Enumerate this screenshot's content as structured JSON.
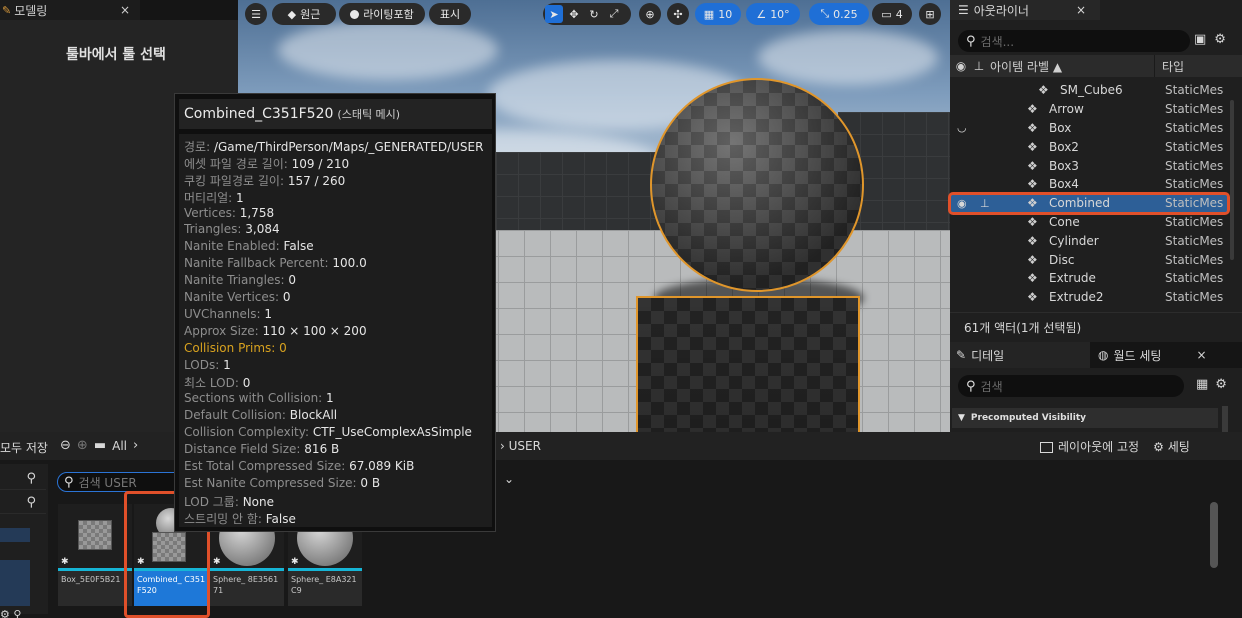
{
  "left_panel": {
    "tab_label": "모델링",
    "tab_close": "×",
    "hint": "툴바에서 툴 선택"
  },
  "viewport_toolbar": {
    "menu": "☰",
    "perspective": "원근",
    "lighting": "라이팅포함",
    "show": "표시",
    "grid_snap": "10",
    "rotate_snap": "10°",
    "scale_snap": "0.25",
    "camera_speed": "4"
  },
  "outliner": {
    "tab_label": "아웃라이너",
    "tab_close": "×",
    "search_placeholder": "검색...",
    "col_label": "아이템 라벨 ▲",
    "col_type": "타입",
    "rows": [
      {
        "name": "SM_Cube6",
        "type": "StaticMes"
      },
      {
        "name": "Arrow",
        "type": "StaticMes"
      },
      {
        "name": "Box",
        "type": "StaticMes"
      },
      {
        "name": "Box2",
        "type": "StaticMes"
      },
      {
        "name": "Box3",
        "type": "StaticMes"
      },
      {
        "name": "Box4",
        "type": "StaticMes"
      },
      {
        "name": "Combined",
        "type": "StaticMes"
      },
      {
        "name": "Cone",
        "type": "StaticMes"
      },
      {
        "name": "Cylinder",
        "type": "StaticMes"
      },
      {
        "name": "Disc",
        "type": "StaticMes"
      },
      {
        "name": "Extrude",
        "type": "StaticMes"
      },
      {
        "name": "Extrude2",
        "type": "StaticMes"
      }
    ],
    "footer": "61개 액터(1개 선택됨)"
  },
  "details": {
    "tab_details": "디테일",
    "tab_world": "월드 세팅",
    "tab_close": "×",
    "search_placeholder": "검색",
    "section": "Precomputed Visibility"
  },
  "content_browser": {
    "save_all": "모두 저장",
    "path_all": "All",
    "path_user": "USER",
    "lock_layout": "레이아웃에 고정",
    "settings": "세팅",
    "search_placeholder": "검색 USER",
    "assets": [
      {
        "name": "Box_5E0F5B21"
      },
      {
        "name": "Combined_ C351F520"
      },
      {
        "name": "Sphere_ 8E356171"
      },
      {
        "name": "Sphere_ E8A321C9"
      }
    ]
  },
  "tooltip": {
    "title": "Combined_C351F520",
    "type": "(스태틱 메시)",
    "lines": [
      {
        "label": "경로: ",
        "value": "/Game/ThirdPerson/Maps/_GENERATED/USER"
      },
      {
        "label": "에셋 파일 경로 길이: ",
        "value": "109 / 210"
      },
      {
        "label": "쿠킹 파일경로 길이: ",
        "value": "157 / 260"
      },
      {
        "label": "머티리얼: ",
        "value": "1"
      },
      {
        "label": "Vertices: ",
        "value": "1,758"
      },
      {
        "label": "Triangles: ",
        "value": "3,084"
      },
      {
        "label": "Nanite Enabled: ",
        "value": "False"
      },
      {
        "label": "Nanite Fallback Percent: ",
        "value": "100.0"
      },
      {
        "label": "Nanite Triangles: ",
        "value": "0"
      },
      {
        "label": "Nanite Vertices: ",
        "value": "0"
      },
      {
        "label": "UVChannels: ",
        "value": "1"
      },
      {
        "label": "Approx Size: ",
        "value": "110 × 100 × 200"
      },
      {
        "label": "Collision Prims: ",
        "value": "0"
      },
      {
        "label": "LODs: ",
        "value": "1"
      },
      {
        "label": "최소 LOD: ",
        "value": "0"
      },
      {
        "label": "Sections with Collision: ",
        "value": "1"
      },
      {
        "label": "Default Collision: ",
        "value": "BlockAll"
      },
      {
        "label": "Collision Complexity: ",
        "value": "CTF_UseComplexAsSimple"
      },
      {
        "label": "Distance Field Size: ",
        "value": "816 B"
      },
      {
        "label": "Est Total Compressed Size: ",
        "value": "67.089 KiB"
      },
      {
        "label": "Est Nanite Compressed Size: ",
        "value": "0 B"
      },
      {
        "label": "LOD 그룹: ",
        "value": "None"
      },
      {
        "label": "스트리밍 안 함: ",
        "value": "False"
      }
    ]
  }
}
